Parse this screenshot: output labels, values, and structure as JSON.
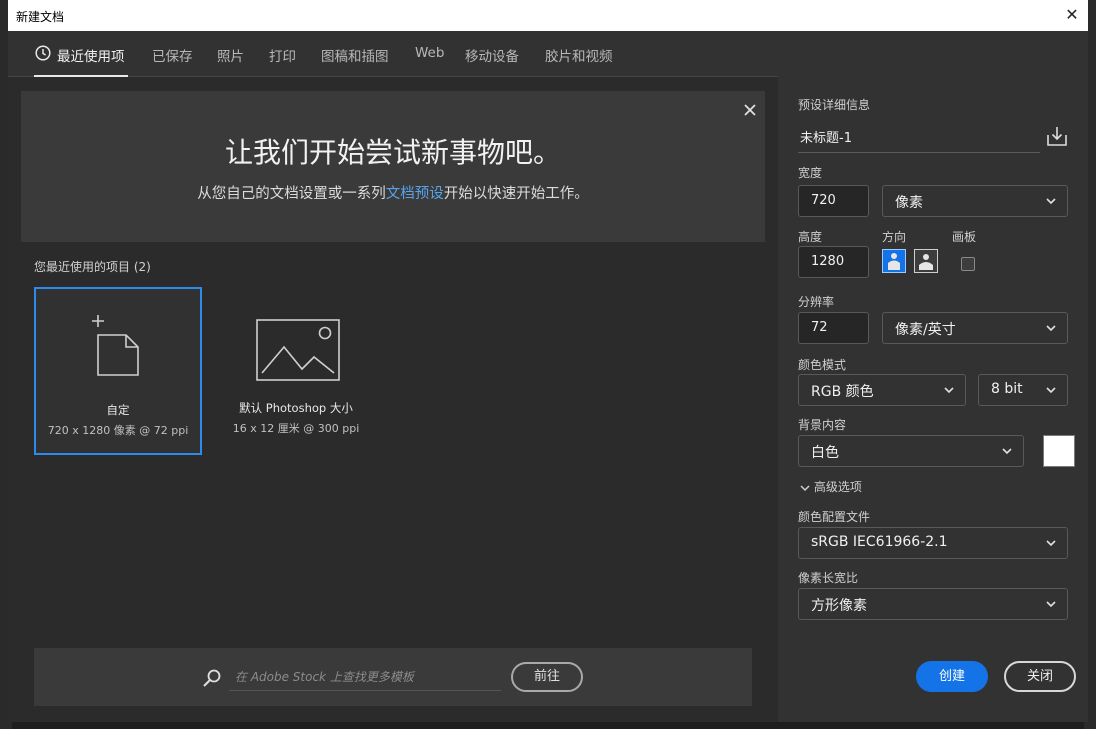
{
  "window": {
    "title": "新建文档"
  },
  "tabs": [
    {
      "label": "最近使用项"
    },
    {
      "label": "已保存"
    },
    {
      "label": "照片"
    },
    {
      "label": "打印"
    },
    {
      "label": "图稿和插图"
    },
    {
      "label": "Web"
    },
    {
      "label": "移动设备"
    },
    {
      "label": "胶片和视频"
    }
  ],
  "banner": {
    "headline": "让我们开始尝试新事物吧。",
    "sub_before": "从您自己的文档设置或一系列",
    "sub_link": "文档预设",
    "sub_after": "开始以快速开始工作。"
  },
  "recent": {
    "label": "您最近使用的项目 (2)",
    "items": [
      {
        "name": "自定",
        "desc": "720 x 1280 像素 @ 72 ppi"
      },
      {
        "name": "默认 Photoshop 大小",
        "desc": "16 x 12 厘米 @ 300 ppi"
      }
    ]
  },
  "search": {
    "placeholder": "在 Adobe Stock 上查找更多模板",
    "go_label": "前往"
  },
  "details": {
    "section_label": "预设详细信息",
    "preset_name": "未标题-1",
    "width_label": "宽度",
    "width_value": "720",
    "width_unit": "像素",
    "height_label": "高度",
    "height_value": "1280",
    "orientation_label": "方向",
    "artboard_label": "画板",
    "resolution_label": "分辨率",
    "resolution_value": "72",
    "resolution_unit": "像素/英寸",
    "color_mode_label": "颜色模式",
    "color_mode": "RGB 颜色",
    "bit_depth": "8 bit",
    "background_label": "背景内容",
    "background": "白色",
    "background_color": "#ffffff",
    "advanced_label": "高级选项",
    "profile_label": "颜色配置文件",
    "profile": "sRGB IEC61966-2.1",
    "aspect_label": "像素长宽比",
    "aspect": "方形像素",
    "create_label": "创建",
    "close_label": "关闭"
  },
  "colors": {
    "accent": "#1473e6",
    "link": "#5aa3ea",
    "selected_border": "#2d8ceb"
  }
}
